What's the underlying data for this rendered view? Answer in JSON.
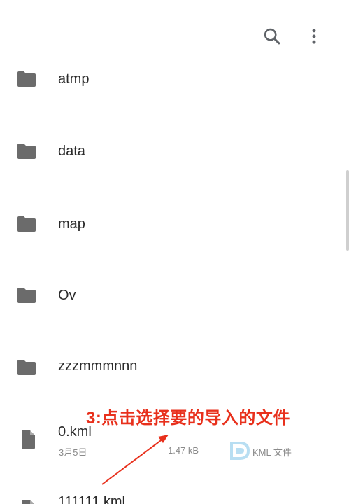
{
  "toolbar": {
    "search_icon": "search-icon",
    "more_icon": "more-vert-icon",
    "icon_color": "#5f6368"
  },
  "items": [
    {
      "type": "folder",
      "name": "atmp"
    },
    {
      "type": "folder",
      "name": "data"
    },
    {
      "type": "folder",
      "name": "map"
    },
    {
      "type": "folder",
      "name": "Ov"
    },
    {
      "type": "folder",
      "name": "zzzmmmnnn"
    },
    {
      "type": "file",
      "name": "0.kml",
      "date": "3月5日",
      "size": "1.47 kB",
      "kind": "KML 文件"
    },
    {
      "type": "file",
      "name": "111111.kml"
    }
  ],
  "annotation": {
    "text": "3:点击选择要的导入的文件",
    "color": "#e8301c"
  },
  "colors": {
    "folder_icon": "#6b6b6b",
    "text_primary": "#2a2a2a",
    "text_secondary": "#8a8a8a",
    "watermark": "#7fc4e8"
  }
}
